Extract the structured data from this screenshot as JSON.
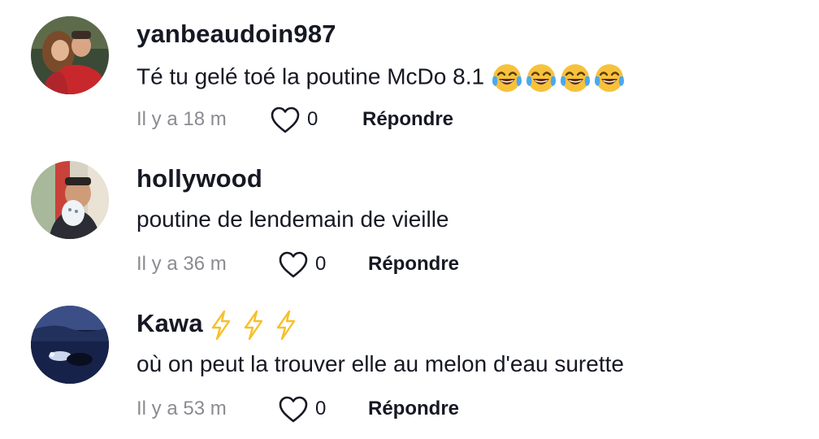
{
  "comments": [
    {
      "username": "yanbeaudoin987",
      "text": "Té tu gelé toé la poutine McDo 8.1",
      "emoji": [
        "face-with-tears-of-joy-icon",
        "face-with-tears-of-joy-icon",
        "face-with-tears-of-joy-icon",
        "face-with-tears-of-joy-icon"
      ],
      "time": "Il y a 18 m",
      "likes": "0",
      "reply_label": "Répondre"
    },
    {
      "username": "hollywood",
      "text": "poutine de lendemain de vieille",
      "time": "Il y a 36 m",
      "likes": "0",
      "reply_label": "Répondre"
    },
    {
      "username": "Kawa",
      "username_emoji": [
        "lightning-bolt-icon",
        "lightning-bolt-icon",
        "lightning-bolt-icon"
      ],
      "text": "où on peut la trouver elle au melon d'eau surette",
      "time": "Il y a 53 m",
      "likes": "0",
      "reply_label": "Répondre"
    }
  ],
  "colors": {
    "text_primary": "#161823",
    "text_secondary": "#8a8b91",
    "background": "#ffffff",
    "bolt": "#f7c02a"
  }
}
